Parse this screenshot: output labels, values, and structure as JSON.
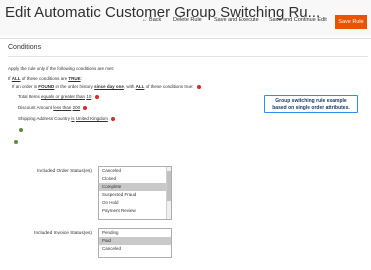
{
  "header": {
    "title": "Edit Automatic Customer Group Switching Ru...",
    "back_label": "← Back",
    "delete_label": "Delete Rule",
    "save_execute_label": "Save and Execute",
    "save_continue_label": "Save and Continue Edit",
    "save_label": "Save Rule"
  },
  "conditions": {
    "section_title": "Conditions",
    "intro": "Apply the rule only if the following conditions are met:",
    "line1": {
      "pre": "If",
      "all": "ALL",
      "mid": "of these conditions are",
      "true": "TRUE",
      "post": ":"
    },
    "line2": {
      "pre": "If an order is",
      "found": "FOUND",
      "mid1": "in the order history",
      "since": "since day one",
      "mid2": ", with",
      "all": "ALL",
      "post": "of these conditions true:"
    },
    "total_items": {
      "label": "Total Items",
      "op": "equals or greater than",
      "value": "10"
    },
    "discount": {
      "label": "Discount Amount",
      "op": "less than",
      "value": "200"
    },
    "shipping": {
      "label": "Shipping Address Country",
      "op": "is",
      "value": "United Kingdom"
    }
  },
  "note": {
    "line1": "Group switching rule example",
    "line2": "based on single order attributes."
  },
  "order_status": {
    "label": "Included Order Status(es)",
    "options": [
      "Canceled",
      "Closed",
      "Complete",
      "Suspected Fraud",
      "On Hold",
      "Payment Review"
    ],
    "selected_index": 2
  },
  "invoice_status": {
    "label": "Included Invoice Status(es)",
    "options": [
      "Pending",
      "Paid",
      "Canceled"
    ],
    "selected_index": 1
  },
  "colors": {
    "accent": "#eb5202",
    "note_border": "#2d8ef0",
    "remove": "#e22626",
    "add": "#5e8a3f"
  }
}
